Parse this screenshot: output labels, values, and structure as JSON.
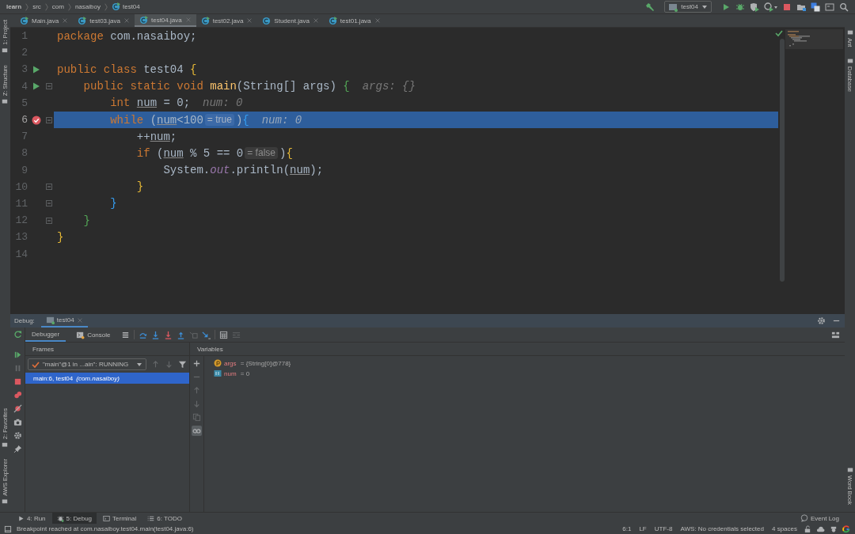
{
  "breadcrumbs": [
    {
      "label": "learn",
      "kind": "project"
    },
    {
      "label": "src",
      "kind": "folder"
    },
    {
      "label": "com",
      "kind": "folder"
    },
    {
      "label": "nasaiboy",
      "kind": "folder"
    },
    {
      "label": "test04",
      "kind": "class"
    }
  ],
  "run_config": {
    "label": "test04"
  },
  "tabs": [
    {
      "label": "Main.java",
      "selected": false,
      "runnable": true
    },
    {
      "label": "test03.java",
      "selected": false,
      "runnable": true
    },
    {
      "label": "test04.java",
      "selected": true,
      "runnable": true
    },
    {
      "label": "test02.java",
      "selected": false,
      "runnable": true
    },
    {
      "label": "Student.java",
      "selected": false,
      "runnable": false
    },
    {
      "label": "test01.java",
      "selected": false,
      "runnable": true
    }
  ],
  "left_stripe": {
    "top": [
      "1: Project",
      "Z: Structure"
    ],
    "bottom": [
      "2: Favorites",
      "AWS Explorer"
    ]
  },
  "right_stripe": {
    "top": [
      "Ant",
      "Database"
    ],
    "bottom": [
      "Word Book"
    ]
  },
  "editor": {
    "lines": [
      {
        "number": "1",
        "run": false,
        "breakpoint": false,
        "fold": false,
        "current": false,
        "tokens": [
          {
            "kind": "kw",
            "text": "package"
          },
          {
            "kind": "plain",
            "text": " com.nasaiboy;"
          }
        ]
      },
      {
        "number": "2",
        "run": false,
        "breakpoint": false,
        "fold": false,
        "current": false
      },
      {
        "number": "3",
        "run": true,
        "breakpoint": false,
        "fold": false,
        "current": false,
        "tokens": [
          {
            "kind": "kw",
            "text": "public class "
          },
          {
            "kind": "plain",
            "text": "test04 "
          },
          {
            "kind": "b1",
            "text": "{"
          }
        ]
      },
      {
        "number": "4",
        "run": true,
        "breakpoint": false,
        "fold": true,
        "current": false,
        "tokens": [
          {
            "kind": "kw",
            "text": "    public static void "
          },
          {
            "kind": "fn",
            "text": "main"
          },
          {
            "kind": "plain",
            "text": "(String[] args) "
          },
          {
            "kind": "b2",
            "text": "{"
          },
          {
            "kind": "hint",
            "text": "args: {}"
          }
        ]
      },
      {
        "number": "5",
        "run": false,
        "breakpoint": false,
        "fold": false,
        "current": false,
        "tokens": [
          {
            "kind": "kw",
            "text": "        int "
          },
          {
            "kind": "var",
            "text": "num"
          },
          {
            "kind": "plain",
            "text": " = 0;"
          },
          {
            "kind": "hint",
            "text": "num: 0"
          }
        ]
      },
      {
        "number": "6",
        "run": false,
        "breakpoint": true,
        "fold": true,
        "current": true,
        "tokens": [
          {
            "kind": "kw",
            "text": "        while "
          },
          {
            "kind": "plain",
            "text": "("
          },
          {
            "kind": "var",
            "text": "num"
          },
          {
            "kind": "plain",
            "text": "<100"
          },
          {
            "kind": "inlay",
            "text": "= true"
          },
          {
            "kind": "plain",
            "text": ")"
          },
          {
            "kind": "b3",
            "text": "{"
          },
          {
            "kind": "hint",
            "text": "num: 0"
          }
        ]
      },
      {
        "number": "7",
        "run": false,
        "breakpoint": false,
        "fold": false,
        "current": false,
        "tokens": [
          {
            "kind": "plain",
            "text": "            ++"
          },
          {
            "kind": "var",
            "text": "num"
          },
          {
            "kind": "plain",
            "text": ";"
          }
        ]
      },
      {
        "number": "8",
        "run": false,
        "breakpoint": false,
        "fold": false,
        "current": false,
        "tokens": [
          {
            "kind": "kw",
            "text": "            if "
          },
          {
            "kind": "plain",
            "text": "("
          },
          {
            "kind": "var",
            "text": "num"
          },
          {
            "kind": "plain",
            "text": " % 5 == 0"
          },
          {
            "kind": "inlay",
            "text": "= false"
          },
          {
            "kind": "plain",
            "text": ")"
          },
          {
            "kind": "b1",
            "text": "{"
          }
        ]
      },
      {
        "number": "9",
        "run": false,
        "breakpoint": false,
        "fold": false,
        "current": false,
        "tokens": [
          {
            "kind": "plain",
            "text": "                System."
          },
          {
            "kind": "field",
            "text": "out"
          },
          {
            "kind": "plain",
            "text": ".println("
          },
          {
            "kind": "var",
            "text": "num"
          },
          {
            "kind": "plain",
            "text": ");"
          }
        ]
      },
      {
        "number": "10",
        "run": false,
        "breakpoint": false,
        "fold": true,
        "current": false,
        "tokens": [
          {
            "kind": "b1",
            "text": "            }"
          }
        ]
      },
      {
        "number": "11",
        "run": false,
        "breakpoint": false,
        "fold": true,
        "current": false,
        "tokens": [
          {
            "kind": "b3",
            "text": "        }"
          }
        ]
      },
      {
        "number": "12",
        "run": false,
        "breakpoint": false,
        "fold": true,
        "current": false,
        "tokens": [
          {
            "kind": "b2",
            "text": "    }"
          }
        ]
      },
      {
        "number": "13",
        "run": false,
        "breakpoint": false,
        "fold": false,
        "current": false,
        "tokens": [
          {
            "kind": "b1",
            "text": "}"
          }
        ]
      },
      {
        "number": "14",
        "run": false,
        "breakpoint": false,
        "fold": false,
        "current": false
      }
    ]
  },
  "debug": {
    "title": "Debug:",
    "session_tab": "test04",
    "tabs": [
      {
        "label": "Debugger",
        "selected": true,
        "kind": "debugger"
      },
      {
        "label": "Console",
        "selected": false,
        "kind": "console"
      }
    ],
    "toolbar": [
      {
        "kind": "threads",
        "disabled": false
      },
      {
        "kind": "step-over",
        "disabled": false
      },
      {
        "kind": "step-into",
        "disabled": false
      },
      {
        "kind": "force-step-into",
        "disabled": false
      },
      {
        "kind": "step-out",
        "disabled": false
      },
      {
        "kind": "drop-frame",
        "disabled": true
      },
      {
        "kind": "run-to-cursor",
        "disabled": false
      },
      {
        "kind": "evaluate",
        "disabled": false
      },
      {
        "kind": "trace",
        "disabled": true
      }
    ],
    "side_actions": [
      {
        "kind": "resume",
        "disabled": false
      },
      {
        "kind": "pause",
        "disabled": true
      },
      {
        "kind": "stop",
        "disabled": false
      },
      {
        "kind": "breakpoints",
        "disabled": false
      },
      {
        "kind": "mute",
        "disabled": false
      },
      {
        "kind": "camera",
        "disabled": false
      },
      {
        "kind": "settings",
        "disabled": false
      },
      {
        "kind": "pin",
        "disabled": false
      }
    ],
    "frames_title": "Frames",
    "thread": "\"main\"@1 in ...ain\": RUNNING",
    "frame_tools": [
      {
        "kind": "up",
        "disabled": true
      },
      {
        "kind": "down",
        "disabled": true
      },
      {
        "kind": "filter",
        "disabled": false
      }
    ],
    "frames": [
      {
        "method": "main:6, test04",
        "package": "(com.nasaiboy)",
        "selected": true
      }
    ],
    "variables_title": "Variables",
    "variable_tools": [
      {
        "kind": "add",
        "disabled": false,
        "on": false
      },
      {
        "kind": "remove",
        "disabled": true,
        "on": false
      },
      {
        "kind": "up",
        "disabled": true,
        "on": false
      },
      {
        "kind": "down",
        "disabled": true,
        "on": false
      },
      {
        "kind": "copy",
        "disabled": true,
        "on": false
      },
      {
        "kind": "watches",
        "disabled": false,
        "on": true
      }
    ],
    "variables": [
      {
        "name": "args",
        "value": "= {String[0]@778}",
        "kind": "parameter"
      },
      {
        "name": "num",
        "value": "= 0",
        "kind": "primitive"
      }
    ]
  },
  "tool_buttons": [
    {
      "label": "4: Run",
      "selected": false,
      "kind": "run"
    },
    {
      "label": "5: Debug",
      "selected": true,
      "kind": "debug"
    },
    {
      "label": "Terminal",
      "selected": false,
      "kind": "terminal"
    },
    {
      "label": "6: TODO",
      "selected": false,
      "kind": "todo"
    }
  ],
  "event_log": "Event Log",
  "status": {
    "message": "Breakpoint reached at com.nasaiboy.test04.main(test04.java:6)",
    "items": [
      "6:1",
      "LF",
      "UTF-8",
      "AWS: No credentials selected",
      "4 spaces"
    ]
  }
}
